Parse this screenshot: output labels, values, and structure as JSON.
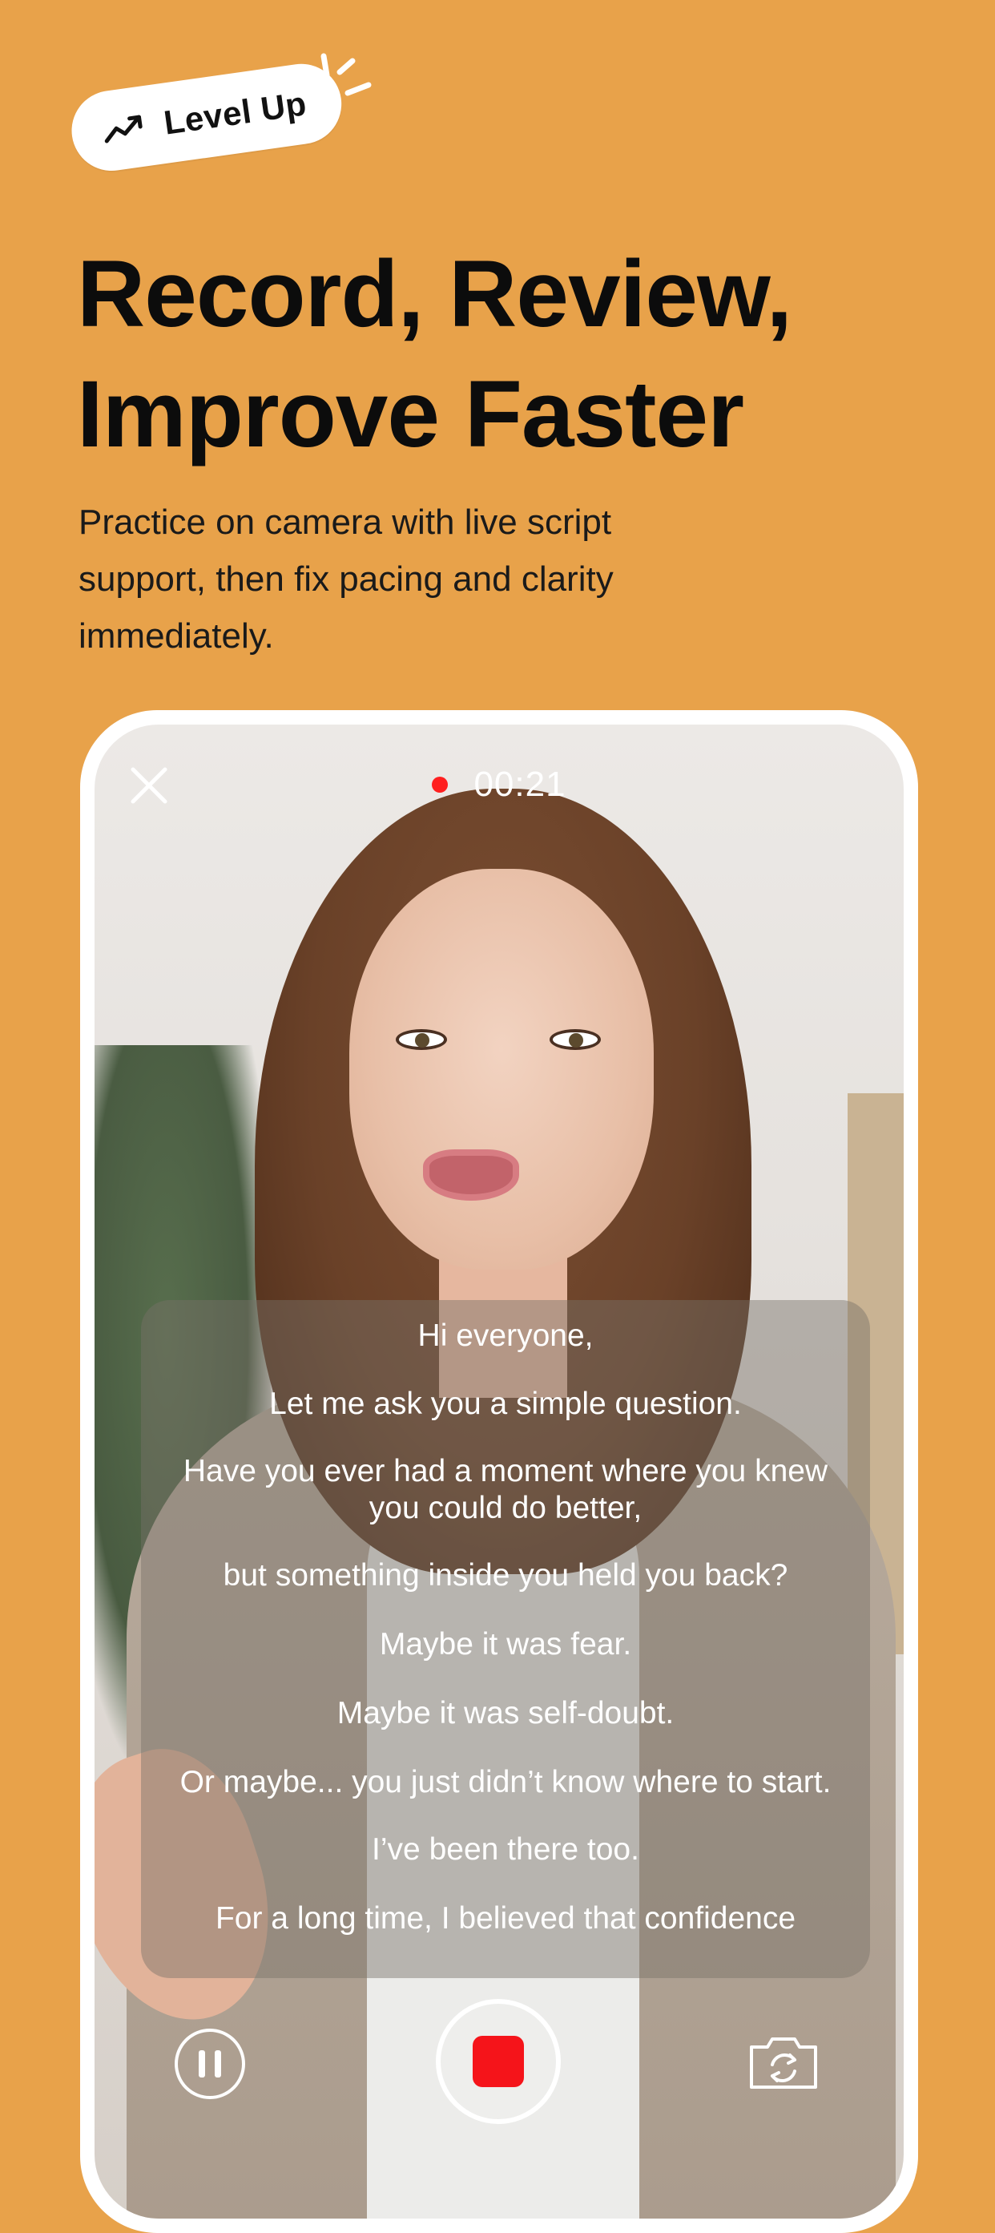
{
  "badge": {
    "label": "Level Up",
    "icon": "trending-up-icon"
  },
  "headline": "Record, Review,\nImprove Faster",
  "subtitle": "Practice on camera with live script support, then fix pacing and clarity immediately.",
  "recording": {
    "timer": "00:21",
    "indicator_color": "#ff1f1f"
  },
  "script": {
    "lines": [
      "Hi everyone,",
      "Let me ask you a simple question.",
      "Have you ever had a moment where you knew you could do better,",
      "but something inside you held you back?",
      "Maybe it was fear.",
      "Maybe it was self-doubt.",
      "Or maybe... you just didn’t know where to start.",
      "I’ve been there too.",
      "For a long time, I believed that confidence"
    ]
  },
  "controls": {
    "close_icon": "close-icon",
    "pause_icon": "pause-icon",
    "record_icon": "stop-record-icon",
    "flip_icon": "camera-flip-icon"
  },
  "colors": {
    "background": "#E8A24A",
    "headline": "#0c0c0c",
    "record": "#f5141a"
  }
}
